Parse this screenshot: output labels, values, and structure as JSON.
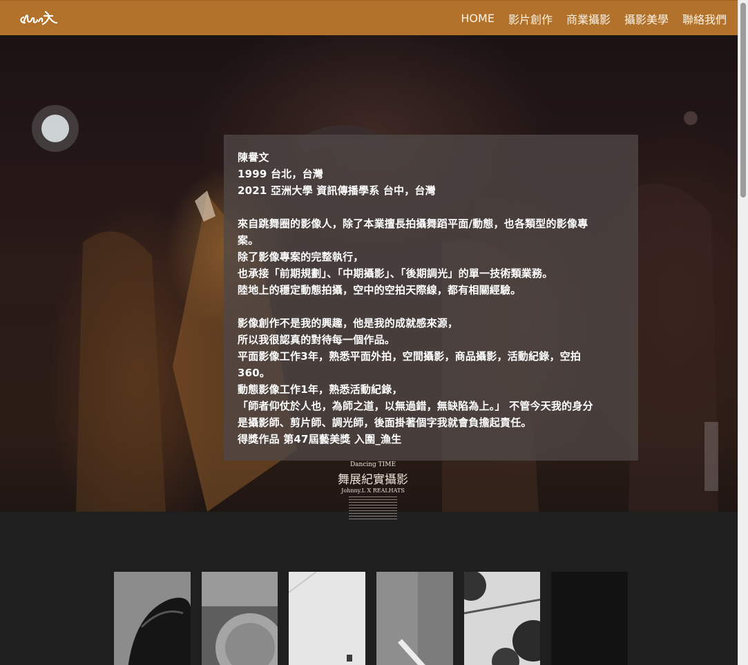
{
  "header": {
    "logo_icon": "signature-logo-icon",
    "nav": [
      {
        "label": "HOME"
      },
      {
        "label": "影片創作"
      },
      {
        "label": "商業攝影"
      },
      {
        "label": "攝影美學"
      },
      {
        "label": "聯絡我們"
      }
    ],
    "colors": {
      "bar": "#b2722b",
      "text": "#fdf3e6"
    }
  },
  "intro": {
    "lines": [
      "陳譽文",
      "1999 台北，台灣",
      "2021 亞洲大學 資訊傳播學系 台中，台灣",
      "",
      "來自跳舞圈的影像人，除了本業擅長拍攝舞蹈平面/動態，也各類型的影像專",
      "案。",
      "除了影像專案的完整執行，",
      "也承接「前期規劃」、「中期攝影」、「後期調光」的單一技術類業務。",
      "陸地上的穩定動態拍攝，空中的空拍天際線，都有相關經驗。",
      "",
      "影像創作不是我的興趣，他是我的成就感來源，",
      "所以我很認真的對待每一個作品。",
      "平面影像工作3年，熟悉平面外拍，空間攝影，商品攝影，活動紀錄，空拍",
      "360。",
      "動態影像工作1年，熟悉活動紀錄，",
      "「師者仰仗於人也，為師之道，以無過錯，無缺陷為上。」 不管今天我的身分",
      "是攝影師、剪片師、調光師，後面掛著個字我就會負擔起責任。",
      "得獎作品 第47屆藝美獎 入圍_漁生"
    ]
  },
  "poster": {
    "en_title": "Dancing TIME",
    "zh_title": "舞展紀實攝影",
    "credit": "Johnny.L X REALHATS"
  },
  "gallery": {
    "items": [
      {
        "name": "portrait-hair"
      },
      {
        "name": "portrait-cap"
      },
      {
        "name": "white-wall"
      },
      {
        "name": "concrete-pole"
      },
      {
        "name": "sky-trees"
      },
      {
        "name": "dark-frame"
      }
    ]
  }
}
